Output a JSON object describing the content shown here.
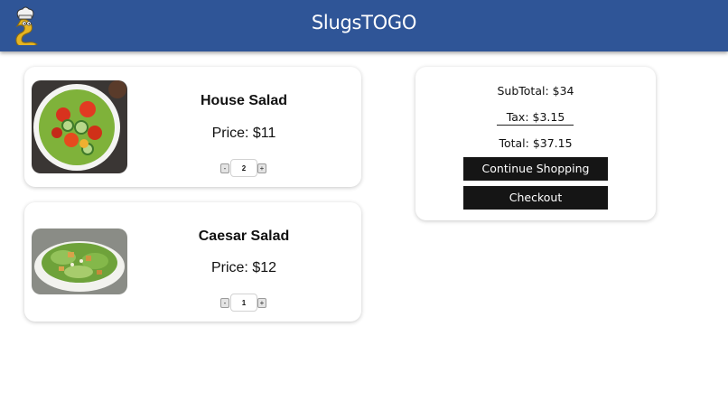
{
  "header": {
    "title": "SlugsTOGO",
    "logo": "slug-chef-logo"
  },
  "cart": {
    "items": [
      {
        "name": "House Salad",
        "price_label": "Price: $11",
        "quantity": "2",
        "minus": "-",
        "plus": "+",
        "image": "house-salad-photo"
      },
      {
        "name": "Caesar Salad",
        "price_label": "Price: $12",
        "quantity": "1",
        "minus": "-",
        "plus": "+",
        "image": "caesar-salad-photo"
      }
    ]
  },
  "summary": {
    "subtotal": "SubTotal: $34",
    "tax": "Tax: $3.15",
    "total": "Total: $37.15",
    "continue_label": "Continue Shopping",
    "checkout_label": "Checkout"
  },
  "colors": {
    "header_bg": "#2f5597",
    "button_bg": "#151515"
  }
}
